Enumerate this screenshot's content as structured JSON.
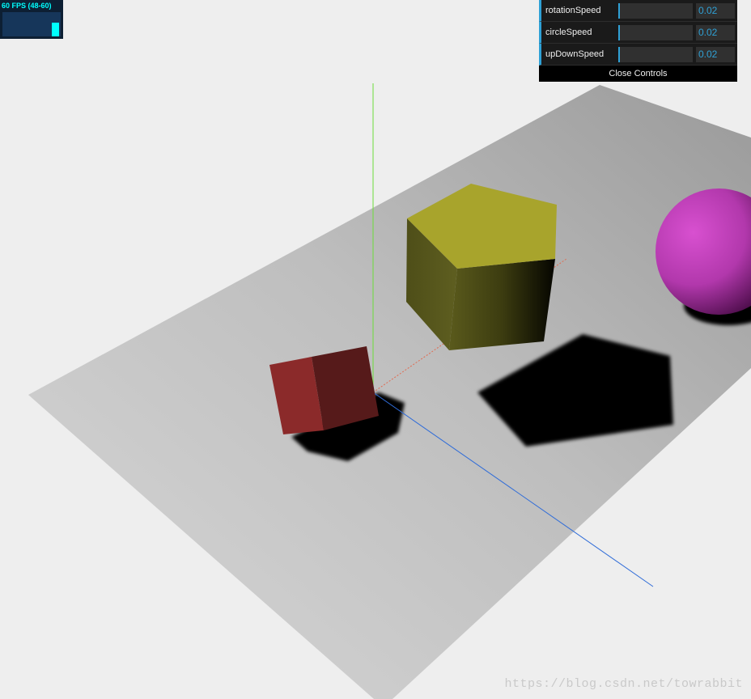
{
  "stats": {
    "fps_text": "60 FPS (48-60)"
  },
  "gui": {
    "controls": [
      {
        "name": "rotationSpeed",
        "value": "0.02",
        "fraction": 0.02
      },
      {
        "name": "circleSpeed",
        "value": "0.02",
        "fraction": 0.02
      },
      {
        "name": "upDownSpeed",
        "value": "0.02",
        "fraction": 0.02
      }
    ],
    "close_label": "Close Controls",
    "accent_color": "#2fa1d6"
  },
  "scene": {
    "objects": [
      "plane",
      "cube",
      "pentagonal-prism",
      "sphere",
      "axes-helper"
    ],
    "colors": {
      "background": "#eeeeee",
      "cube": "#8b2a2a",
      "prism": "#a8a42c",
      "sphere": "#c840c0",
      "axis_x": "#e06a50",
      "axis_y": "#6cdc3a",
      "axis_z": "#2f6cd8"
    }
  },
  "watermark": "https://blog.csdn.net/towrabbit"
}
